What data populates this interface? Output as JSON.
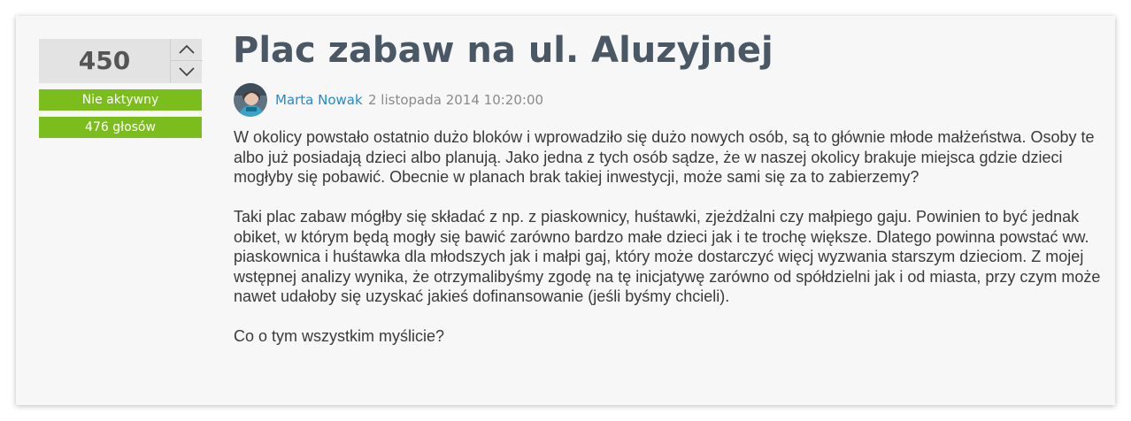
{
  "idea": {
    "vote_count": "450",
    "status": "Nie aktywny",
    "votes_label": "476 głosów",
    "title": "Plac zabaw na ul. Aluzyjnej",
    "author": "Marta Nowak",
    "date": "2 listopada 2014 10:20:00",
    "paragraphs": [
      " W okolicy powstało ostatnio dużo bloków i wprowadziło się dużo nowych osób, są to głównie młode małżeństwa. Osoby te albo już posiadają dzieci albo planują. Jako jedna z tych osób sądze, że w naszej okolicy brakuje miejsca gdzie dzieci mogłyby się pobawić. Obecnie w planach brak takiej inwestycji, może sami się za to zabierzemy?",
      "Taki plac zabaw mógłby się składać z np. z piaskownicy, huśtawki, zjeżdżalni czy małpiego gaju. Powinien to być jednak obiket, w którym będą mogły się bawić zarówno bardzo małe dzieci jak i te trochę większe. Dlatego powinna powstać ww. piaskownica i huśtawka dla młodszych jak i małpi gaj, który może dostarczyć więcj wyzwania starszym dzieciom. Z mojej wstępnej analizy wynika, że otrzymalibyśmy zgodę na tę inicjatywę zarówno od spółdzielni jak i od miasta, przy czym może nawet udałoby się uzyskać jakieś dofinansowanie (jeśli byśmy chcieli).",
      "Co o tym wszystkim myślicie?"
    ]
  },
  "icons": {
    "upvote": "chevron-up-icon",
    "downvote": "chevron-down-icon"
  },
  "colors": {
    "badge": "#7cbd1e",
    "title": "#4a5866",
    "author_link": "#1f8ad6",
    "card_background": "#f7f7f7",
    "vote_box": "#e3e3e3"
  }
}
